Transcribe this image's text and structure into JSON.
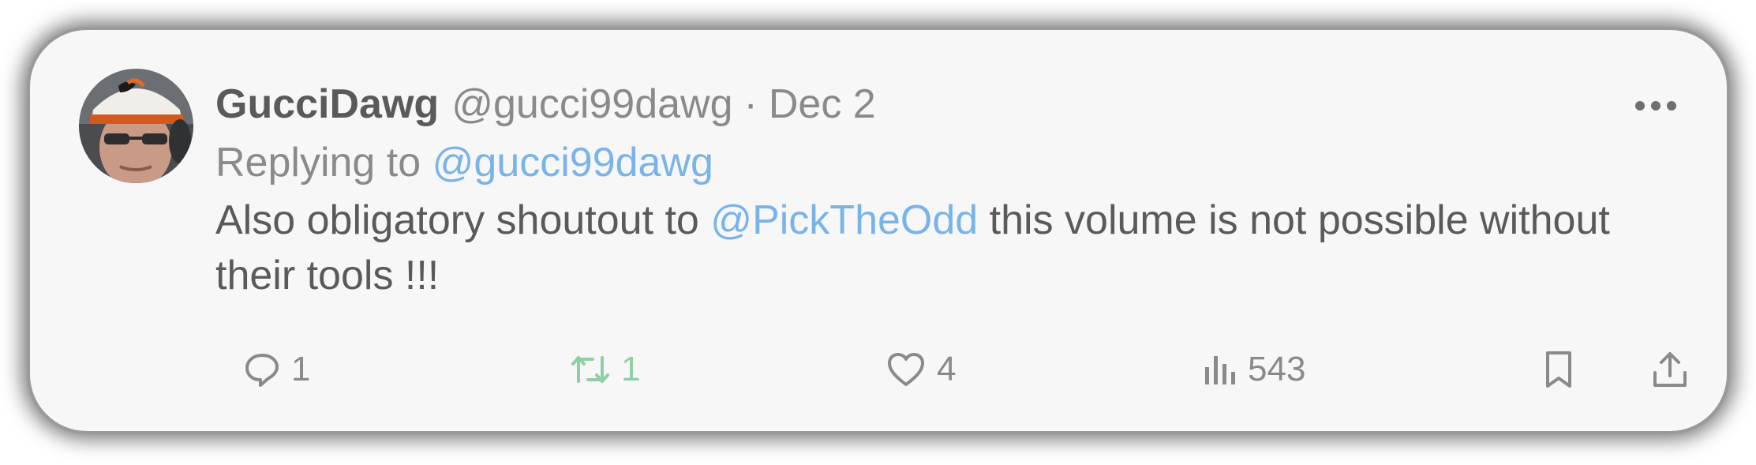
{
  "tweet": {
    "author": {
      "display_name": "GucciDawg",
      "handle": "@gucci99dawg"
    },
    "separator": "·",
    "date": "Dec 2",
    "reply_prefix": "Replying to",
    "reply_to": "@gucci99dawg",
    "text": {
      "before_mention": "Also obligatory shoutout to ",
      "mention": "@PickTheOdd",
      "after_mention": " this volume is not possible without their tools !!!"
    },
    "metrics": {
      "replies": "1",
      "retweets": "1",
      "likes": "4",
      "views": "543"
    }
  },
  "icons": {
    "more": "more-horizontal-icon",
    "reply": "speech-bubble-icon",
    "retweet": "retweet-arrows-icon",
    "like": "heart-icon",
    "views": "bar-chart-icon",
    "bookmark": "bookmark-icon",
    "share": "share-upload-icon"
  },
  "colors": {
    "card_background": "#f7f7f7",
    "primary_text": "#5a5a5a",
    "secondary_text": "#8a8a8a",
    "mention_link": "#78b4ea",
    "retweet_active": "#8fcfa5"
  }
}
